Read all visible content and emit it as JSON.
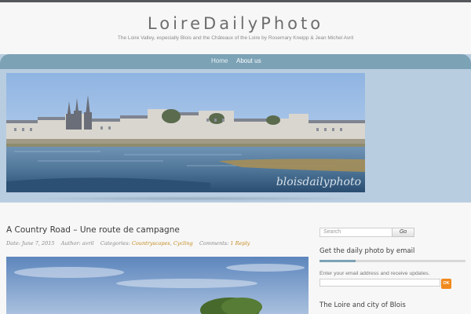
{
  "site": {
    "title": "LoireDailyPhoto",
    "tagline": "The Loire Valley, especially Blois and the Châteaux of the Loire by Rosemary Kneipp & Jean Michel Avril",
    "watermark": "bloisdailyphoto"
  },
  "nav": {
    "items": [
      {
        "label": "Home"
      },
      {
        "label": "About us"
      }
    ]
  },
  "post": {
    "title": "A Country Road – Une route de campagne",
    "date_label": "Date:",
    "date": "June 7, 2015",
    "author_label": "Author:",
    "author": "avril",
    "categories_label": "Categories:",
    "categories": [
      "Countryscapes",
      "Cycling"
    ],
    "comments_label": "Comments:",
    "comments": "1 Reply"
  },
  "sidebar": {
    "search": {
      "placeholder": "Search",
      "button": "Go"
    },
    "widget_email": {
      "title": "Get the daily photo by email",
      "text": "Enter your email address and receive updates.",
      "ok": "OK"
    },
    "widget_loire": {
      "title": "The Loire and city of Blois"
    }
  },
  "colors": {
    "nav_bg": "#7ca2b6",
    "header_band": "#b9cde0",
    "link": "#c28a1c",
    "ok_button": "#f08a1c"
  }
}
